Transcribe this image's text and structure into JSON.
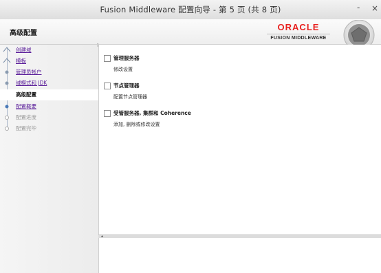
{
  "window": {
    "title": "Fusion Middleware 配置向导 - 第 5 页 (共 8 页)",
    "minimize_label": "-",
    "close_label": "×"
  },
  "header": {
    "page_title": "高级配置",
    "logo_oracle": "ORACLE",
    "logo_fusion": "FUSION MIDDLEWARE"
  },
  "sidebar": {
    "steps": [
      {
        "label": "创建域",
        "state": "link"
      },
      {
        "label": "模板",
        "state": "link"
      },
      {
        "label": "管理员帐户",
        "state": "link"
      },
      {
        "label": "域模式和 JDK",
        "state": "link"
      },
      {
        "label": "高级配置",
        "state": "active"
      },
      {
        "label": "配置概要",
        "state": "link"
      },
      {
        "label": "配置进度",
        "state": "disabled"
      },
      {
        "label": "配置完毕",
        "state": "disabled"
      }
    ]
  },
  "main": {
    "options": [
      {
        "name": "管理服务器",
        "desc": "修改设置",
        "checked": false
      },
      {
        "name": "节点管理器",
        "desc": "配置节点管理器",
        "checked": false
      },
      {
        "name": "受管服务器, 集群和 Coherence",
        "desc": "添加, 删除或修改设置",
        "checked": false
      }
    ]
  },
  "colors": {
    "link": "#5b1f9a",
    "oracle_red": "#e8211f",
    "active_step_bg": "#ffffff"
  }
}
